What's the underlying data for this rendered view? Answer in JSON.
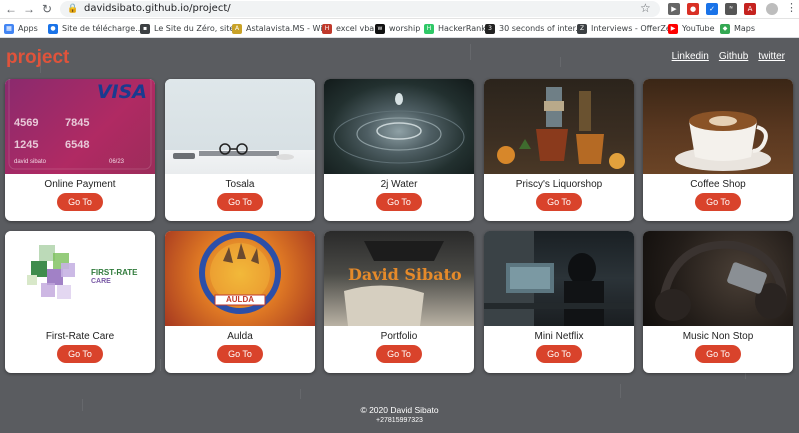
{
  "browser": {
    "url": "davidsibato.github.io/project/",
    "bookmarks": [
      {
        "label": "Apps",
        "icon": "apps-grid-icon",
        "color": "#4285f4"
      },
      {
        "label": "Site de télécharge...",
        "icon": "globe-icon",
        "color": "#1a73e8"
      },
      {
        "label": "Le Site du Zéro, site...",
        "icon": "page-icon",
        "color": "#3c4043"
      },
      {
        "label": "Astalavista.MS - Wi...",
        "icon": "astalavista-icon",
        "color": "#c9a227"
      },
      {
        "label": "excel vba",
        "icon": "hl-icon",
        "color": "#c0392b"
      },
      {
        "label": "worship",
        "icon": "worship-icon",
        "color": "#111111"
      },
      {
        "label": "HackerRank",
        "icon": "hackerrank-icon",
        "color": "#2ec866"
      },
      {
        "label": "30 seconds of inter...",
        "icon": "thirty-icon",
        "color": "#222222"
      },
      {
        "label": "Interviews - OfferZen",
        "icon": "offerzen-icon",
        "color": "#3c4043"
      },
      {
        "label": "YouTube",
        "icon": "youtube-icon",
        "color": "#ff0000"
      },
      {
        "label": "Maps",
        "icon": "maps-icon",
        "color": "#34a853"
      }
    ]
  },
  "site": {
    "logo": "project",
    "nav": [
      "Linkedin",
      "Github",
      "twitter"
    ],
    "button_label": "Go To",
    "accent": "#d9432b"
  },
  "projects": [
    {
      "title": "Online Payment",
      "thumb": "credit-card-image"
    },
    {
      "title": "Tosala",
      "thumb": "glasses-desk-image"
    },
    {
      "title": "2j Water",
      "thumb": "water-drop-image"
    },
    {
      "title": "Priscy's Liquorshop",
      "thumb": "liquor-drinks-image"
    },
    {
      "title": "Coffee Shop",
      "thumb": "coffee-cup-image"
    },
    {
      "title": "First-Rate Care",
      "thumb": "first-rate-care-logo"
    },
    {
      "title": "Aulda",
      "thumb": "aulda-logo"
    },
    {
      "title": "Portfolio",
      "thumb": "david-sibato-portfolio-image"
    },
    {
      "title": "Mini Netflix",
      "thumb": "computer-desk-image"
    },
    {
      "title": "Music Non Stop",
      "thumb": "headphones-image"
    }
  ],
  "card_texts": {
    "visa": "VISA",
    "card_row1a": "4569",
    "card_row1b": "7845",
    "card_row2a": "1245",
    "card_row2b": "6548",
    "card_name": "david sibato",
    "card_exp": "06/23",
    "frc_name": "FIRST-RATE",
    "frc_sub": "CARE",
    "aulda": "AULDA",
    "portfolio_sign": "David Sibato"
  },
  "footer": {
    "copyright": "© 2020 David Sibato",
    "phone": "+27815997323"
  }
}
